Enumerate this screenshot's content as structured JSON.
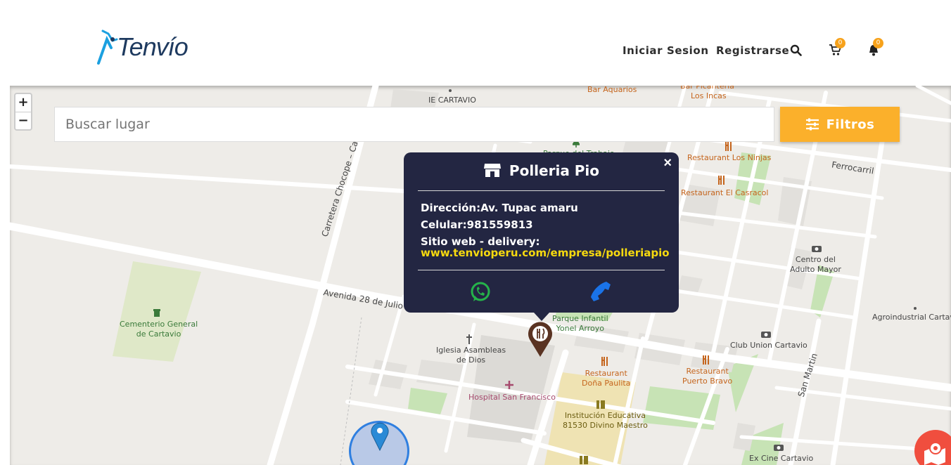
{
  "header": {
    "logo_text": "Tenvío",
    "nav": {
      "login_label": "Iniciar Sesion",
      "register_label": "Registrarse"
    },
    "cart_count": "0",
    "notifications_count": "0",
    "icons": [
      "search-icon",
      "cart-icon",
      "bell-icon"
    ]
  },
  "map": {
    "search_placeholder": "Buscar lugar",
    "filter_label": "Filtros",
    "zoom_in_label": "+",
    "zoom_out_label": "−",
    "labels": {
      "ie_cartavio": "IE CARTAVIO",
      "bar_aquarios": "Bar Aquarios",
      "bar_picanteria": "Bar Picantería",
      "los_incas": "Los Incas",
      "parque_del_trabajo": "Parque del Trabajo",
      "restaurant_los_ninjas": "Restaurant Los Ninjas",
      "restaurant_el_casracol": "Restaurant El Casracol",
      "ferrocarril": "Ferrocarril",
      "centro_adulto_mayor": "Centro del\nAdulto Mayor",
      "agroindustrial": "Agroindustrial Cartav",
      "club_union": "Club Union Cartavio",
      "restaurant_puerto_bravo": "Restaurant\nPuerto Bravo",
      "san_martin": "San Martin",
      "carretera": "Carretera Chocope – Ca",
      "avenida": "Avenida 28 de Julio",
      "cementerio": "Cementerio General\nde Cartavio",
      "parque_infantil": "Parque Infantil\nYonel Arroyo",
      "iglesia": "Iglesia Asambleas\nde Dios",
      "restaurant_dona_paulita": "Restaurant\nDoña Paulita",
      "hospital": "Hospital San Francisco",
      "institucion": "Institución Educativa\n81530 Divino Maestro",
      "ex_cine": "Ex Cine Cartavio"
    }
  },
  "popup": {
    "title": "Polleria Pio",
    "address_line": "Dirección:Av. Tupac amaru",
    "phone_line": "Celular:981559813",
    "website_label": "Sitio web - delivery:",
    "website_url": "www.tenvioperu.com/empresa/polleriapio",
    "close_label": "×"
  },
  "colors": {
    "accent_orange": "#fbb02b",
    "popup_bg": "#232642",
    "link_yellow": "#f6d90f",
    "whatsapp_green": "#25b34a",
    "phone_blue": "#1a73e8"
  }
}
